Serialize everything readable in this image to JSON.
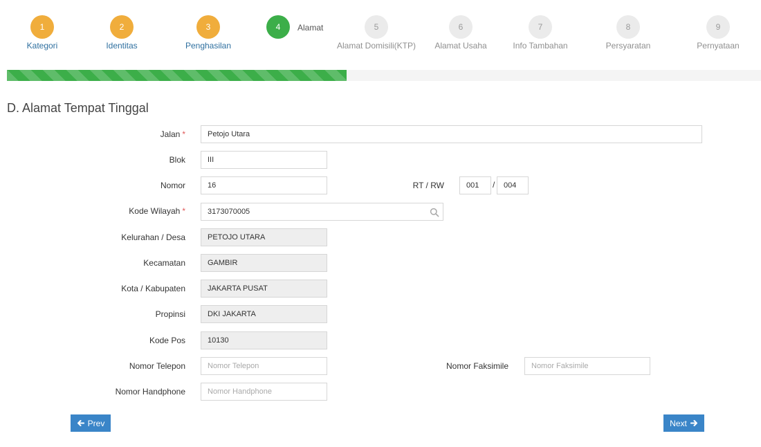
{
  "stepper": {
    "steps": [
      {
        "num": "1",
        "label": "Kategori",
        "state": "done"
      },
      {
        "num": "2",
        "label": "Identitas",
        "state": "done"
      },
      {
        "num": "3",
        "label": "Penghasilan",
        "state": "done"
      },
      {
        "num": "4",
        "label": "Alamat",
        "state": "active"
      },
      {
        "num": "5",
        "label": "Alamat Domisili(KTP)",
        "state": "pending"
      },
      {
        "num": "6",
        "label": "Alamat Usaha",
        "state": "pending"
      },
      {
        "num": "7",
        "label": "Info Tambahan",
        "state": "pending"
      },
      {
        "num": "8",
        "label": "Persyaratan",
        "state": "pending"
      },
      {
        "num": "9",
        "label": "Pernyataan",
        "state": "pending"
      }
    ]
  },
  "progress": {
    "fraction": 0.45
  },
  "section": {
    "title": "D. Alamat Tempat Tinggal"
  },
  "form": {
    "jalan": {
      "label": "Jalan",
      "required": "*",
      "value": "Petojo Utara"
    },
    "blok": {
      "label": "Blok",
      "value": "III"
    },
    "nomor": {
      "label": "Nomor",
      "value": "16"
    },
    "rtrw": {
      "label": "RT / RW",
      "rt": "001",
      "separator": "/",
      "rw": "004"
    },
    "kode_wilayah": {
      "label": "Kode Wilayah",
      "required": "*",
      "value": "3173070005"
    },
    "kelurahan": {
      "label": "Kelurahan / Desa",
      "value": "PETOJO UTARA"
    },
    "kecamatan": {
      "label": "Kecamatan",
      "value": "GAMBIR"
    },
    "kota": {
      "label": "Kota / Kabupaten",
      "value": "JAKARTA PUSAT"
    },
    "propinsi": {
      "label": "Propinsi",
      "value": "DKI JAKARTA"
    },
    "kode_pos": {
      "label": "Kode Pos",
      "value": "10130"
    },
    "telepon": {
      "label": "Nomor Telepon",
      "placeholder": "Nomor Telepon",
      "value": ""
    },
    "faksimile": {
      "label": "Nomor Faksimile",
      "placeholder": "Nomor Faksimile",
      "value": ""
    },
    "handphone": {
      "label": "Nomor Handphone",
      "placeholder": "Nomor Handphone",
      "value": ""
    }
  },
  "buttons": {
    "prev": "Prev",
    "next": "Next"
  },
  "colors": {
    "done": "#f0ad3c",
    "active": "#3cae49",
    "pending": "#ebebeb",
    "primary": "#3a85c8",
    "required": "#e05a5a"
  }
}
